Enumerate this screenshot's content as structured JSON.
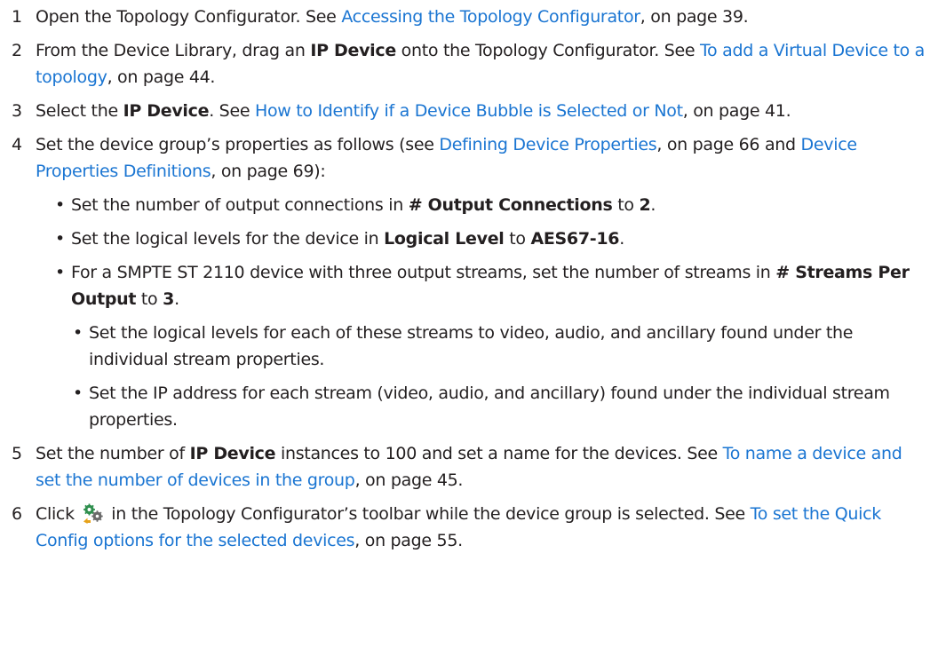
{
  "steps": [
    {
      "num": "1",
      "t1": "Open the Topology Configurator. See ",
      "link": "Accessing the Topology Configurator",
      "t2": ", on page 39."
    },
    {
      "num": "2",
      "t1": "From the Device Library, drag an ",
      "b1": "IP Device",
      "t2": " onto the Topology Configurator. See ",
      "link": "To add a Virtual Device to a topology",
      "t3": ", on page 44."
    },
    {
      "num": "3",
      "t1": "Select the ",
      "b1": "IP Device",
      "t2": ". See ",
      "link": "How to Identify if a Device Bubble is Selected or Not",
      "t3": ", on page 41."
    },
    {
      "num": "4",
      "t1": "Set the device group’s properties as follows (see ",
      "link1": "Defining Device Properties",
      "t2": ", on page 66 and ",
      "link2": "Device Properties Definitions",
      "t3": ", on page 69):"
    },
    {
      "num": "5",
      "t1": "Set the number of ",
      "b1": "IP Device",
      "t2": " instances to 100 and set a name for the devices. See ",
      "link": "To name a device and set the number of devices in the group",
      "t3": ", on page 45."
    },
    {
      "num": "6",
      "t1": "Click ",
      "icon": "quick-config-icon",
      "t2": " in the Topology Configurator’s toolbar while the device group is selected. See ",
      "link": "To set the Quick Config options for the selected devices",
      "t3": ", on page 55."
    }
  ],
  "bullets": [
    {
      "t1": "Set the number of output connections in ",
      "b1": "# Output Connections",
      "t2": " to ",
      "b2": "2",
      "t3": "."
    },
    {
      "t1": "Set the logical levels for the device in ",
      "b1": "Logical Level",
      "t2": " to ",
      "b2": "AES67-16",
      "t3": "."
    },
    {
      "t1": "For a SMPTE ST 2110 device with three output streams, set the number of streams in ",
      "b1": "# Streams Per Output",
      "t2": " to ",
      "b2": "3",
      "t3": "."
    }
  ],
  "subbullets": [
    {
      "text": "Set the logical levels for each of these streams to video, audio, and ancillary found under the individual stream properties."
    },
    {
      "text": "Set the IP address for each stream (video, audio, and ancillary) found under the individual stream properties."
    }
  ],
  "bullet_char": "•",
  "colors": {
    "text": "#231f20",
    "link": "#1a75d2"
  }
}
